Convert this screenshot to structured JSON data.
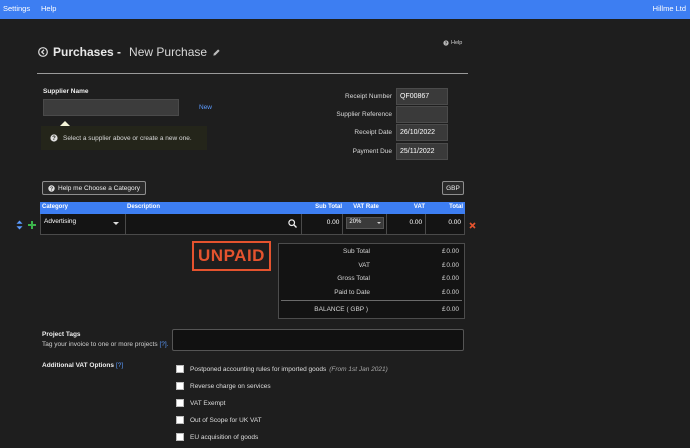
{
  "topbar": {
    "nav": [
      {
        "label": "Settings"
      },
      {
        "label": "Help"
      }
    ],
    "company": "Hillme Ltd",
    "bg_color": "#3d7ef2"
  },
  "page": {
    "title": "Purchases -",
    "subtitle": "New Purchase",
    "help_label": "Help"
  },
  "supplier": {
    "label": "Supplier Name",
    "value": "",
    "new_label": "New",
    "hint": "Select a supplier above or create a new one."
  },
  "receipt": {
    "number_label": "Receipt Number",
    "number_value": "QF00867",
    "reference_label": "Supplier Reference",
    "reference_value": "",
    "date_label": "Receipt Date",
    "date_value": "26/10/2022",
    "due_label": "Payment Due",
    "due_value": "25/11/2022"
  },
  "buttons": {
    "category_help": "Help me Choose a Category",
    "currency": "GBP"
  },
  "line_table": {
    "headers": [
      "Category",
      "Description",
      "Sub Total",
      "VAT Rate",
      "VAT",
      "Total"
    ],
    "rows": [
      {
        "category": "Advertising",
        "description": "",
        "sub_total": "0.00",
        "vat_rate": "20%",
        "vat": "0.00",
        "total": "0.00"
      }
    ]
  },
  "status": {
    "label": "UNPAID",
    "color": "#e5532e"
  },
  "totals": {
    "currency_symbol": "£",
    "lines": [
      {
        "label": "Sub Total",
        "value": "0.00"
      },
      {
        "label": "VAT",
        "value": "0.00"
      },
      {
        "label": "Gross Total",
        "value": "0.00"
      },
      {
        "label": "Paid to Date",
        "value": "0.00"
      }
    ],
    "balance_label": "BALANCE ( GBP )",
    "balance_value": "0.00"
  },
  "project_tags": {
    "title": "Project Tags",
    "description": "Tag your invoice to one or more projects",
    "help_link": "[?]."
  },
  "vat_options": {
    "title": "Additional VAT Options",
    "help_link": "[?]",
    "options": [
      {
        "label": "Postponed accounting rules for imported goods",
        "note": "(From 1st Jan 2021)",
        "checked": false
      },
      {
        "label": "Reverse charge on services",
        "note": "",
        "checked": false
      },
      {
        "label": "VAT Exempt",
        "note": "",
        "checked": false
      },
      {
        "label": "Out of Scope for UK VAT",
        "note": "",
        "checked": false
      },
      {
        "label": "EU acquisition of goods",
        "note": "",
        "checked": false
      }
    ]
  }
}
